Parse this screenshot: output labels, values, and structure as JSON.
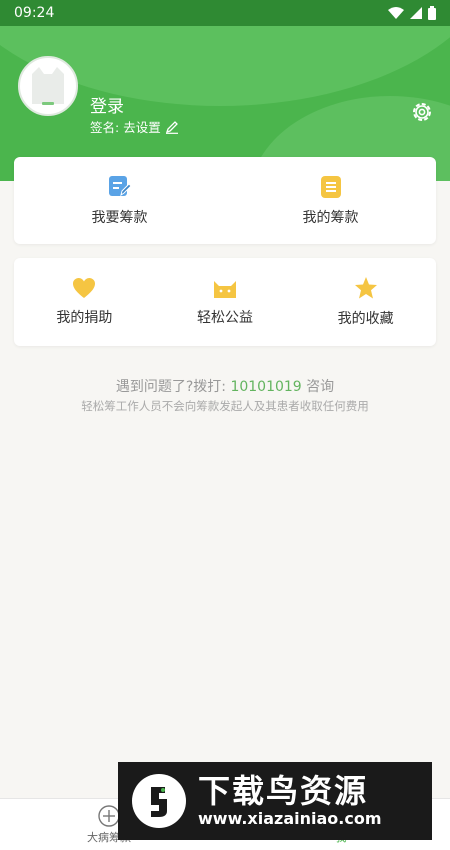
{
  "status_bar": {
    "time": "09:24"
  },
  "profile": {
    "login_label": "登录",
    "sign_prefix": "签名:",
    "sign_action": "去设置"
  },
  "funding": {
    "items": [
      {
        "label": "我要筹款",
        "icon": "edit-document-icon"
      },
      {
        "label": "我的筹款",
        "icon": "list-document-icon"
      }
    ]
  },
  "menu": {
    "items": [
      {
        "label": "我的捐助",
        "icon": "heart-icon"
      },
      {
        "label": "轻松公益",
        "icon": "cat-icon"
      },
      {
        "label": "我的收藏",
        "icon": "star-icon"
      }
    ]
  },
  "help": {
    "prefix": "遇到问题了?拨打:",
    "phone": "10101019",
    "suffix": " 咨询",
    "disclaimer": "轻松筹工作人员不会向筹款发起人及其患者收取任何费用"
  },
  "tabbar": {
    "left_label": "大病筹款",
    "right_label": "我"
  },
  "watermark": {
    "title": "下载鸟资源",
    "url": "www.xiazainiao.com"
  },
  "colors": {
    "primary_green": "#4bb54d",
    "icon_blue": "#5aa3e6",
    "icon_yellow": "#f5c542",
    "phone_green": "#63b45f"
  }
}
